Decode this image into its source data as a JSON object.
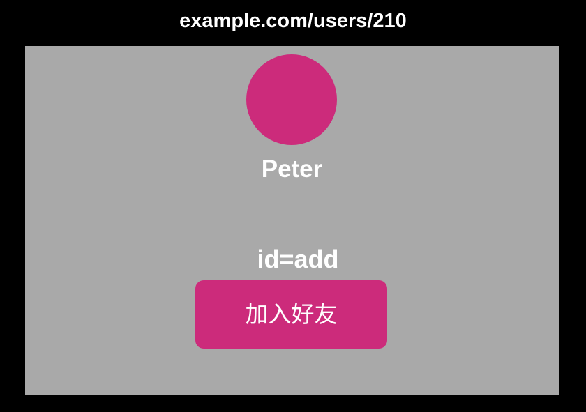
{
  "browser": {
    "url": "example.com/users/210"
  },
  "profile": {
    "name": "Peter",
    "avatar_color": "#cc2b7b"
  },
  "action": {
    "element_id_label": "id=add",
    "add_friend_label": "加入好友",
    "button_color": "#cc2b7b"
  },
  "colors": {
    "background": "#000000",
    "viewport": "#a9a9a9",
    "text": "#ffffff"
  }
}
